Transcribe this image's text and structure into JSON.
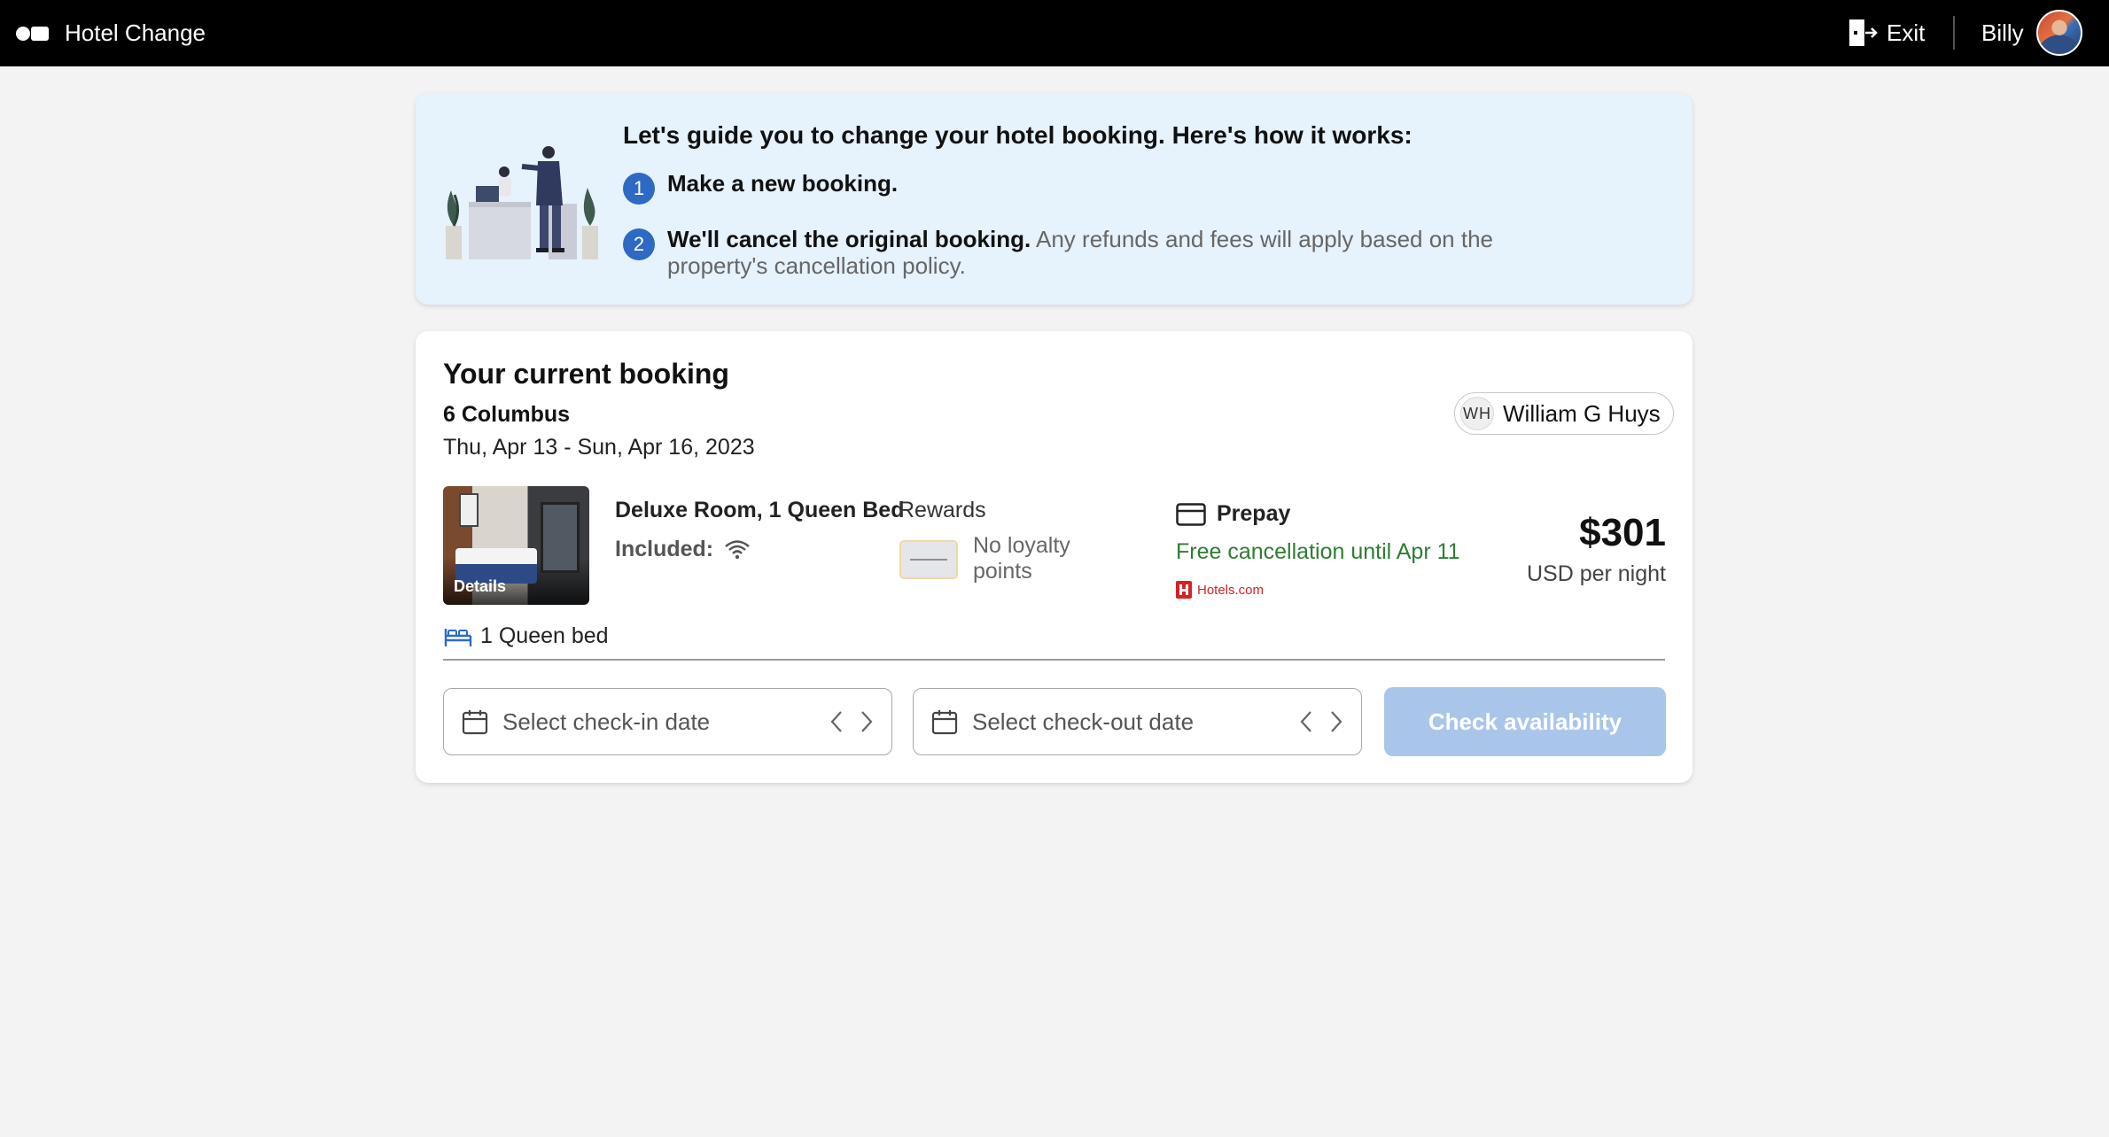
{
  "topbar": {
    "app_title": "Hotel Change",
    "exit_label": "Exit",
    "user_name": "Billy"
  },
  "guide": {
    "title": "Let's guide you to change your hotel booking. Here's how it works:",
    "steps": [
      {
        "number": "1",
        "bold": "Make a new booking.",
        "text": ""
      },
      {
        "number": "2",
        "bold": "We'll cancel the original booking.",
        "text": " Any refunds and fees will apply based on the property's cancellation policy."
      }
    ]
  },
  "booking": {
    "title": "Your current booking",
    "hotel_name": "6 Columbus",
    "dates": "Thu, Apr 13 - Sun, Apr 16, 2023",
    "guest": {
      "initials": "WH",
      "name": "William G Huys"
    },
    "room": {
      "details_label": "Details",
      "name": "Deluxe Room, 1 Queen Bed",
      "included_label": "Included:",
      "included_icons": [
        "wifi-icon"
      ],
      "bed": "1 Queen bed"
    },
    "rewards": {
      "title": "Rewards",
      "text": "No loyalty points"
    },
    "payment": {
      "type": "Prepay",
      "cancellation": "Free cancellation until Apr 11",
      "provider": "Hotels.com"
    },
    "price": {
      "amount": "$301",
      "unit": "USD per night"
    }
  },
  "date_search": {
    "checkin_placeholder": "Select check-in date",
    "checkout_placeholder": "Select check-out date",
    "submit_label": "Check availability"
  },
  "colors": {
    "topbar": "#000000",
    "guide_bg": "#e6f2fc",
    "step_badge": "#2e6ac4",
    "free_cancel": "#2e7d32",
    "button_disabled": "#a9c6ea",
    "hotels_brand": "#d32323"
  }
}
